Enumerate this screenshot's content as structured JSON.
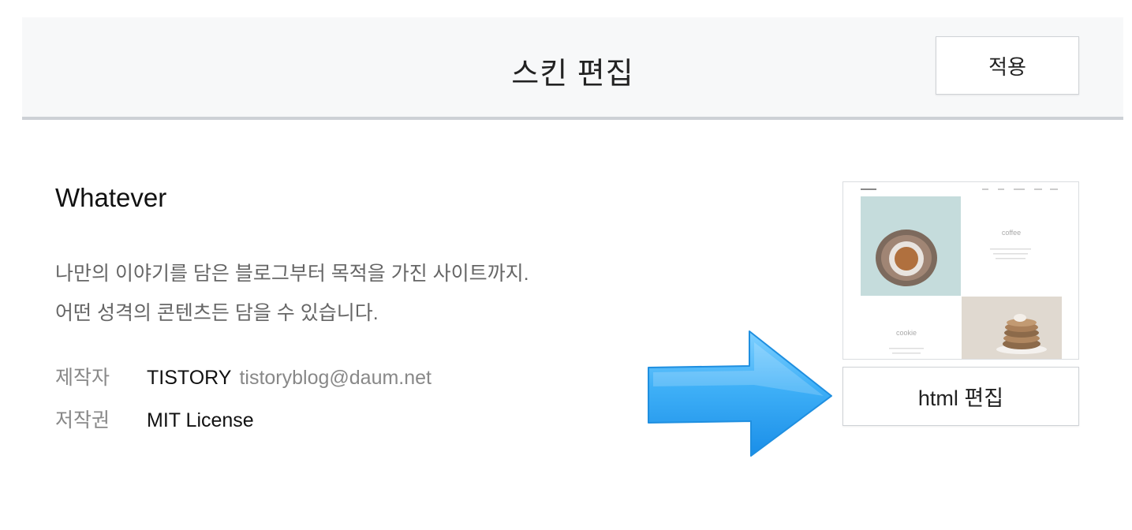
{
  "header": {
    "title": "스킨 편집",
    "apply_label": "적용"
  },
  "skin": {
    "name": "Whatever",
    "description": [
      "나만의 이야기를 담은 블로그부터 목적을 가진 사이트까지.",
      "어떤 성격의 콘텐츠든 담을 수 있습니다."
    ],
    "author_label": "제작자",
    "author_name": "TISTORY",
    "author_email": "tistoryblog@daum.net",
    "license_label": "저작권",
    "license_value": "MIT License"
  },
  "preview": {
    "coffee_label": "coffee",
    "cookie_label": "cookie"
  },
  "html_edit_label": "html 편집",
  "colors": {
    "arrow": "#3aaaf5",
    "header_bg": "#f7f8f9",
    "header_border": "#cdd1d6"
  },
  "icons": {
    "arrow": "right-arrow-icon"
  }
}
